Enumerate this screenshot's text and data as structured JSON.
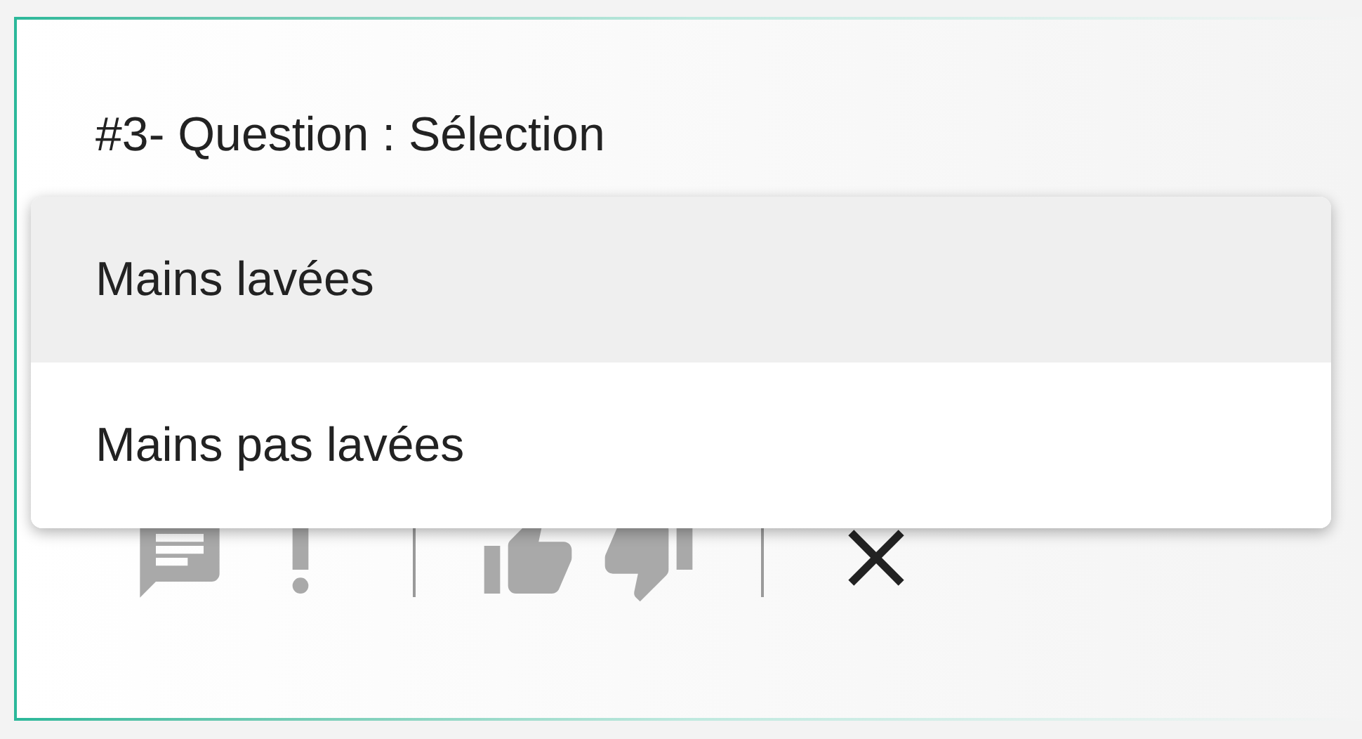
{
  "question": {
    "title": "#3- Question : Sélection"
  },
  "menu": {
    "options": [
      {
        "label": "Mains lavées",
        "selected": true
      },
      {
        "label": "Mains pas lavées",
        "selected": false
      }
    ]
  },
  "actions": [
    {
      "kind": "comment"
    },
    {
      "kind": "alert"
    },
    {
      "kind": "divider"
    },
    {
      "kind": "thumb-up"
    },
    {
      "kind": "thumb-down"
    },
    {
      "kind": "divider"
    },
    {
      "kind": "close"
    }
  ]
}
